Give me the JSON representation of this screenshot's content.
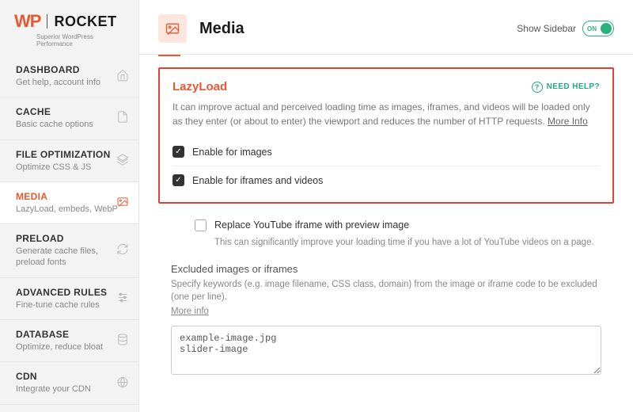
{
  "logo": {
    "wp": "WP",
    "rocket": "ROCKET",
    "tagline": "Superior WordPress Performance"
  },
  "sidebar": {
    "items": [
      {
        "title": "DASHBOARD",
        "desc": "Get help, account info",
        "icon": "home-icon"
      },
      {
        "title": "CACHE",
        "desc": "Basic cache options",
        "icon": "file-icon"
      },
      {
        "title": "FILE OPTIMIZATION",
        "desc": "Optimize CSS & JS",
        "icon": "layers-icon"
      },
      {
        "title": "MEDIA",
        "desc": "LazyLoad, embeds, WebP",
        "icon": "image-icon"
      },
      {
        "title": "PRELOAD",
        "desc": "Generate cache files, preload fonts",
        "icon": "refresh-icon"
      },
      {
        "title": "ADVANCED RULES",
        "desc": "Fine-tune cache rules",
        "icon": "sliders-icon"
      },
      {
        "title": "DATABASE",
        "desc": "Optimize, reduce bloat",
        "icon": "database-icon"
      },
      {
        "title": "CDN",
        "desc": "Integrate your CDN",
        "icon": "globe-icon"
      }
    ]
  },
  "header": {
    "title": "Media",
    "show_sidebar_label": "Show Sidebar",
    "toggle_state": "ON"
  },
  "lazyload": {
    "title": "LazyLoad",
    "need_help": "NEED HELP?",
    "desc": "It can improve actual and perceived loading time as images, iframes, and videos will be loaded only as they enter (or about to enter) the viewport and reduces the number of HTTP requests.",
    "more_info": "More Info",
    "opt1": "Enable for images",
    "opt2": "Enable for iframes and videos"
  },
  "youtube": {
    "label": "Replace YouTube iframe with preview image",
    "hint": "This can significantly improve your loading time if you have a lot of YouTube videos on a page."
  },
  "excluded": {
    "title": "Excluded images or iframes",
    "desc": "Specify keywords (e.g. image filename, CSS class, domain) from the image or iframe code to be excluded (one per line).",
    "more_info": "More info",
    "textarea_value": "example-image.jpg\nslider-image"
  }
}
